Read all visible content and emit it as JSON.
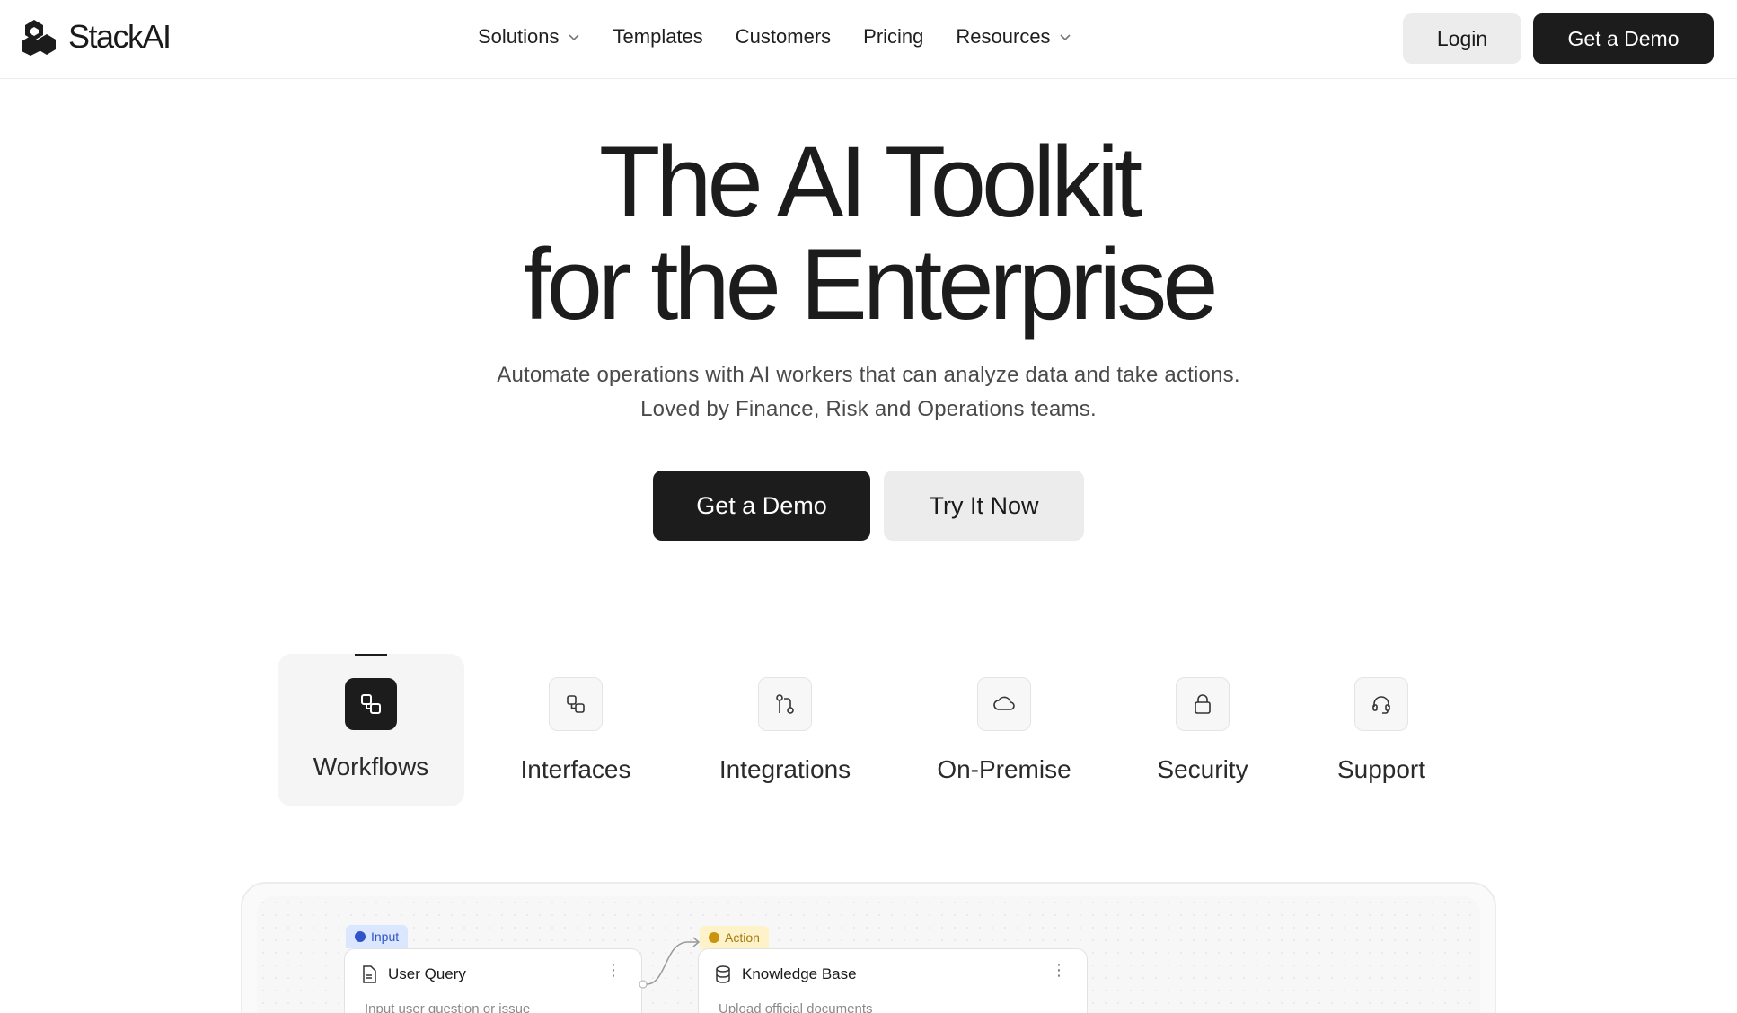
{
  "header": {
    "logo_text": "StackAI",
    "nav": [
      {
        "label": "Solutions",
        "has_dropdown": true
      },
      {
        "label": "Templates",
        "has_dropdown": false
      },
      {
        "label": "Customers",
        "has_dropdown": false
      },
      {
        "label": "Pricing",
        "has_dropdown": false
      },
      {
        "label": "Resources",
        "has_dropdown": true
      }
    ],
    "login_label": "Login",
    "demo_label": "Get a Demo"
  },
  "hero": {
    "title_line1": "The AI Toolkit",
    "title_line2": "for the Enterprise",
    "subtitle_line1": "Automate operations with AI workers that can analyze data and take actions.",
    "subtitle_line2": "Loved by Finance, Risk and Operations teams.",
    "cta_primary": "Get a Demo",
    "cta_secondary": "Try It Now"
  },
  "features": {
    "active": "Workflows",
    "tabs": [
      {
        "label": "Workflows",
        "icon": "workflows-icon"
      },
      {
        "label": "Interfaces",
        "icon": "interfaces-icon"
      },
      {
        "label": "Integrations",
        "icon": "integrations-icon"
      },
      {
        "label": "On-Premise",
        "icon": "cloud-icon"
      },
      {
        "label": "Security",
        "icon": "lock-icon"
      },
      {
        "label": "Support",
        "icon": "headset-icon"
      }
    ]
  },
  "canvas": {
    "input_node": {
      "tag": "Input",
      "title": "User Query",
      "description": "Input user question or issue"
    },
    "action_node": {
      "tag": "Action",
      "title": "Knowledge Base",
      "description": "Upload official documents"
    }
  },
  "colors": {
    "primary_dark": "#1c1c1c",
    "light_button": "#ececec",
    "input_tag_bg": "#dbe6ff",
    "input_tag_text": "#2f55c9",
    "action_tag_bg": "#fdf2c8",
    "action_tag_text": "#a57b10"
  }
}
